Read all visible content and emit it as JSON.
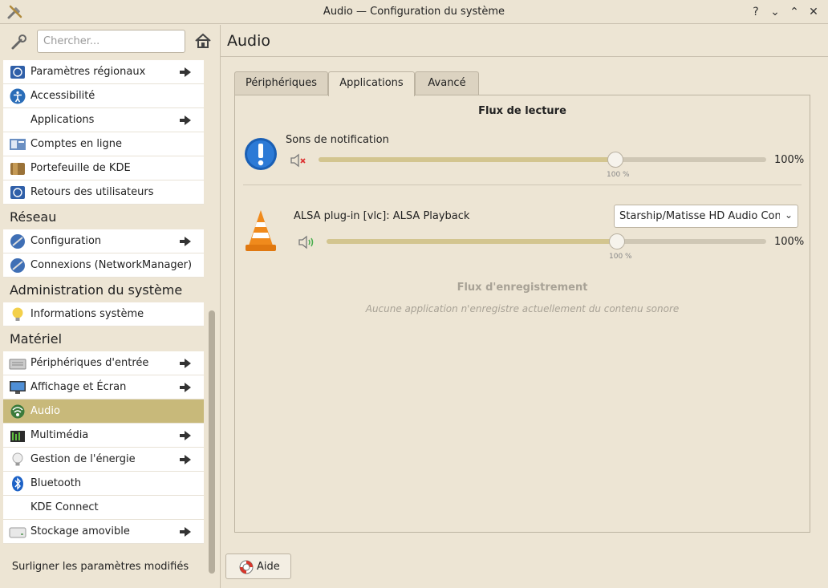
{
  "window": {
    "title": "Audio — Configuration du système",
    "buttons": [
      "?",
      "⌄",
      "⌃",
      "✕"
    ]
  },
  "sidebar": {
    "search_placeholder": "Chercher...",
    "items": [
      {
        "label": "Paramètres régionaux",
        "icon": "globe-flag-icon",
        "arrow": true
      },
      {
        "label": "Accessibilité",
        "icon": "accessibility-icon",
        "arrow": false
      },
      {
        "label": "Applications",
        "icon": "",
        "arrow": true
      },
      {
        "label": "Comptes en ligne",
        "icon": "online-accounts-icon",
        "arrow": false
      },
      {
        "label": "Portefeuille de KDE",
        "icon": "wallet-icon",
        "arrow": false
      },
      {
        "label": "Retours des utilisateurs",
        "icon": "feedback-icon",
        "arrow": false
      }
    ],
    "categories": {
      "network": "Réseau",
      "admin": "Administration du système",
      "hardware": "Matériel"
    },
    "network_items": [
      {
        "label": "Configuration",
        "icon": "network-globe-icon",
        "arrow": true
      },
      {
        "label": "Connexions (NetworkManager)",
        "icon": "network-connections-icon",
        "arrow": false
      }
    ],
    "admin_items": [
      {
        "label": "Informations système",
        "icon": "info-bulb-icon",
        "arrow": false
      }
    ],
    "hardware_items": [
      {
        "label": "Périphériques d'entrée",
        "icon": "input-devices-icon",
        "arrow": true
      },
      {
        "label": "Affichage et Écran",
        "icon": "monitor-icon",
        "arrow": true
      },
      {
        "label": "Audio",
        "icon": "audio-icon",
        "arrow": false,
        "selected": true
      },
      {
        "label": "Multimédia",
        "icon": "multimedia-icon",
        "arrow": true
      },
      {
        "label": "Gestion de l'énergie",
        "icon": "power-bulb-icon",
        "arrow": true
      },
      {
        "label": "Bluetooth",
        "icon": "bluetooth-icon",
        "arrow": false
      },
      {
        "label": "KDE Connect",
        "icon": "",
        "arrow": false
      },
      {
        "label": "Stockage amovible",
        "icon": "removable-storage-icon",
        "arrow": true
      }
    ],
    "highlight_label": "Surligner les paramètres modifiés"
  },
  "main": {
    "title": "Audio",
    "tabs": [
      "Périphériques",
      "Applications",
      "Avancé"
    ],
    "active_tab": "Applications",
    "playback_title": "Flux de lecture",
    "streams": [
      {
        "name": "Sons de notification",
        "volume": 100,
        "volume_label": "100%",
        "small_label": "100 %",
        "muted": true
      },
      {
        "name": "ALSA plug-in [vlc]: ALSA Playback",
        "volume": 100,
        "volume_label": "100%",
        "small_label": "100 %",
        "muted": false,
        "device": "Starship/Matisse HD Audio Controller"
      }
    ],
    "recording_title": "Flux d'enregistrement",
    "recording_empty": "Aucune application n'enregistre actuellement du contenu sonore",
    "help_label": "Aide"
  }
}
